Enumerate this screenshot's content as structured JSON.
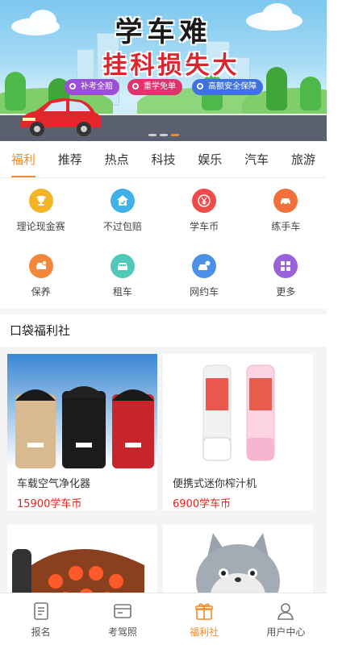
{
  "banner": {
    "line1": "学车难",
    "line2": "挂科损失大",
    "pills": [
      {
        "label": "补考全赔",
        "color": "#9b4fd8"
      },
      {
        "label": "重学免单",
        "color": "#e0336e"
      },
      {
        "label": "高额安全保障",
        "color": "#3f72e0"
      }
    ]
  },
  "tabs": [
    "福利",
    "推荐",
    "热点",
    "科技",
    "娱乐",
    "汽车",
    "旅游"
  ],
  "active_tab": "福利",
  "services": [
    {
      "label": "理论现金赛",
      "icon": "trophy-icon",
      "color": "#f5b425"
    },
    {
      "label": "不过包赔",
      "icon": "home-shield-icon",
      "color": "#3fb0e8"
    },
    {
      "label": "学车币",
      "icon": "yen-coin-icon",
      "color": "#ef4b4b"
    },
    {
      "label": "练手车",
      "icon": "car-icon",
      "color": "#f4703a"
    },
    {
      "label": "保养",
      "icon": "car-care-icon",
      "color": "#f4883a"
    },
    {
      "label": "租车",
      "icon": "rental-car-icon",
      "color": "#52c8b8"
    },
    {
      "label": "网约车",
      "icon": "ride-hailing-icon",
      "color": "#4a90e8"
    },
    {
      "label": "更多",
      "icon": "more-grid-icon",
      "color": "#9a62d8"
    }
  ],
  "section_title": "口袋福利社",
  "products": [
    {
      "name": "车载空气净化器",
      "price": "15900学车币"
    },
    {
      "name": "便携式迷你榨汁机",
      "price": "6900学车币"
    }
  ],
  "bottom_nav": [
    {
      "label": "报名",
      "icon": "signup-doc-icon"
    },
    {
      "label": "考驾照",
      "icon": "license-card-icon"
    },
    {
      "label": "福利社",
      "icon": "gift-icon"
    },
    {
      "label": "用户中心",
      "icon": "user-icon"
    }
  ],
  "active_nav": "福利社",
  "colors": {
    "accent": "#f28c28",
    "price": "#e2231a"
  }
}
